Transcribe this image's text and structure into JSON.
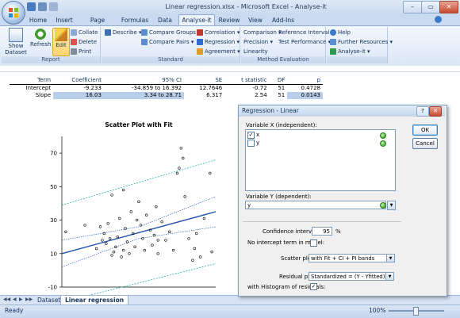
{
  "window": {
    "title": "Linear regression.xlsx - Microsoft Excel - Analyse-it",
    "minimize": "–",
    "maximize": "▭",
    "close": "✕"
  },
  "tabs": [
    "Home",
    "Insert",
    "Page Layout",
    "Formulas",
    "Data",
    "Analyse-it",
    "Review",
    "View",
    "Add-Ins"
  ],
  "active_tab": "Analyse-it",
  "ribbon": {
    "report_group": {
      "label": "Report",
      "show_dataset": "Show Dataset",
      "refresh": "Refresh",
      "edit": "Edit",
      "collate": "Collate",
      "delete": "Delete",
      "print": "Print"
    },
    "standard_group": {
      "label": "Standard",
      "describe": "Describe",
      "compare_groups": "Compare Groups",
      "compare_pairs": "Compare Pairs",
      "correlation": "Correlation",
      "regression": "Regression",
      "agreement": "Agreement"
    },
    "method_group": {
      "label": "Method Evaluation",
      "comparison": "Comparison",
      "reference_interval": "Reference Interval",
      "precision": "Precision",
      "test_performance": "Test Performance",
      "linearity": "Linearity"
    },
    "help_group": {
      "help": "Help",
      "further_resources": "Further Resources",
      "analyse_it": "Analyse-it"
    }
  },
  "stats_table": {
    "headers": [
      "Term",
      "Coefficient",
      "95% CI",
      "SE",
      "t statistic",
      "DF",
      "p"
    ],
    "rows": [
      [
        "Intercept",
        "-9.233",
        "-34.859 to 16.392",
        "12.7646",
        "-0.72",
        "51",
        "0.4728"
      ],
      [
        "Slope",
        "16.03",
        "3.34 to 28.71",
        "6.317",
        "2.54",
        "51",
        "0.0143"
      ]
    ]
  },
  "chart_data": {
    "type": "scatter",
    "title": "Scatter Plot with Fit",
    "xlabel": "",
    "ylabel": "",
    "ylim": [
      -10,
      80
    ],
    "yticks": [
      70,
      50,
      30,
      10,
      -10
    ],
    "xlim": [
      0,
      4
    ],
    "grid": false,
    "series": [
      {
        "points": [
          [
            0.1,
            23
          ],
          [
            0.9,
            13
          ],
          [
            1.05,
            18
          ],
          [
            1.1,
            22
          ],
          [
            1.15,
            16
          ],
          [
            1.2,
            28
          ],
          [
            1.25,
            19
          ],
          [
            1.3,
            9
          ],
          [
            1.35,
            11
          ],
          [
            1.4,
            14
          ],
          [
            1.45,
            20
          ],
          [
            1.5,
            31
          ],
          [
            1.55,
            8
          ],
          [
            1.6,
            12
          ],
          [
            1.65,
            25
          ],
          [
            1.7,
            17
          ],
          [
            1.75,
            10
          ],
          [
            1.8,
            35
          ],
          [
            1.85,
            22
          ],
          [
            1.9,
            14
          ],
          [
            1.95,
            30
          ],
          [
            2.0,
            41
          ],
          [
            2.05,
            27
          ],
          [
            2.1,
            19
          ],
          [
            2.15,
            12
          ],
          [
            2.2,
            33
          ],
          [
            2.3,
            24
          ],
          [
            2.35,
            15
          ],
          [
            2.4,
            21
          ],
          [
            2.45,
            38
          ],
          [
            2.5,
            10
          ],
          [
            2.6,
            29
          ],
          [
            2.7,
            18
          ],
          [
            2.8,
            23
          ],
          [
            2.9,
            12
          ],
          [
            3.0,
            58
          ],
          [
            3.05,
            61
          ],
          [
            3.1,
            73
          ],
          [
            3.15,
            67
          ],
          [
            3.2,
            44
          ],
          [
            3.3,
            19
          ],
          [
            3.4,
            6
          ],
          [
            3.45,
            13
          ],
          [
            3.5,
            22
          ],
          [
            3.6,
            8
          ],
          [
            3.7,
            31
          ],
          [
            3.85,
            58
          ],
          [
            0.6,
            27
          ],
          [
            1.0,
            26
          ],
          [
            1.3,
            45
          ],
          [
            1.6,
            48
          ],
          [
            2.5,
            18
          ],
          [
            3.9,
            11
          ]
        ]
      }
    ],
    "fit_line": [
      [
        0,
        10.0
      ],
      [
        4,
        35.0
      ]
    ],
    "ci_band_upper": [
      [
        0,
        18.0
      ],
      [
        2,
        26.0
      ],
      [
        4,
        44.0
      ]
    ],
    "ci_band_lower": [
      [
        0,
        2.0
      ],
      [
        2,
        19.0
      ],
      [
        4,
        26.0
      ]
    ],
    "pi_band_upper": [
      [
        0,
        39.0
      ],
      [
        4,
        66.0
      ]
    ],
    "pi_band_lower": [
      [
        0,
        -19.0
      ],
      [
        4,
        4.0
      ]
    ]
  },
  "sheet_tabs": [
    "Dataset",
    "Linear regression"
  ],
  "active_sheet": "Linear regression",
  "status": {
    "text": "Ready",
    "zoom": "100%"
  },
  "dialog": {
    "title": "Regression - Linear",
    "help": "?",
    "close": "✕",
    "var_x_label": "Variable X (independent):",
    "var_x_items": [
      {
        "name": "x",
        "checked": true
      },
      {
        "name": "y",
        "checked": false
      }
    ],
    "var_y_label": "Variable Y (dependent):",
    "var_y_value": "y",
    "ok": "OK",
    "cancel": "Cancel",
    "confidence_label": "Confidence interval:",
    "confidence_value": "95",
    "confidence_unit": "%",
    "no_intercept_label": "No intercept term in model:",
    "scatter_plot_label": "Scatter plot:",
    "scatter_plot_value": "with Fit + CI + PI bands",
    "residual_plot_label": "Residual plot:",
    "residual_plot_value": "Standardized = (Y - Yfitted) / SD",
    "histogram_label": "with Histogram of residuals:"
  },
  "colors": {
    "ribbon": "#dbe7f6",
    "fit_line": "#1f4fa8",
    "band_line": "#2e6cd1",
    "pi_band_line": "#24b3b3"
  }
}
